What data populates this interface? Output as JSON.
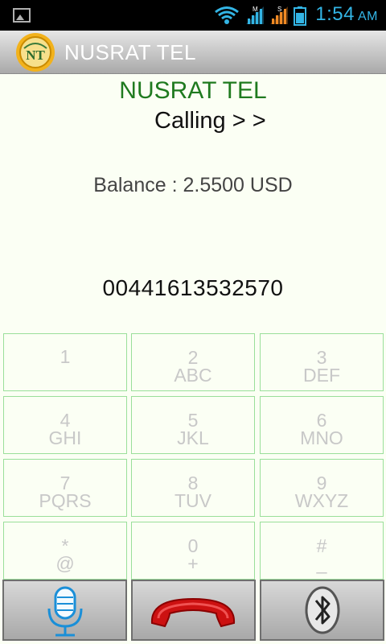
{
  "status_bar": {
    "time": "1:54",
    "ampm": "AM",
    "colors": {
      "icons": "#33b5e5",
      "signal_alt": "#f08a24"
    }
  },
  "action_bar": {
    "title": "NUSRAT TEL",
    "logo_text": "NT"
  },
  "call": {
    "brand": "NUSRAT TEL",
    "status": "Calling > >",
    "balance": "Balance : 2.5500 USD",
    "dialed_number": "00441613532570"
  },
  "keypad": {
    "keys": [
      {
        "digit": "1",
        "letters": ""
      },
      {
        "digit": "2",
        "letters": "ABC"
      },
      {
        "digit": "3",
        "letters": "DEF"
      },
      {
        "digit": "4",
        "letters": "GHI"
      },
      {
        "digit": "5",
        "letters": "JKL"
      },
      {
        "digit": "6",
        "letters": "MNO"
      },
      {
        "digit": "7",
        "letters": "PQRS"
      },
      {
        "digit": "8",
        "letters": "TUV"
      },
      {
        "digit": "9",
        "letters": "WXYZ"
      },
      {
        "digit": "*",
        "letters": "@"
      },
      {
        "digit": "0",
        "letters": "+"
      },
      {
        "digit": "#",
        "letters": "_"
      }
    ]
  },
  "actions": {
    "left_icon": "microphone-icon",
    "center_icon": "hang-up-icon",
    "right_icon": "bluetooth-icon"
  },
  "theme": {
    "brand_green": "#1f7a1f",
    "key_border": "#9adf9a",
    "background": "#fbfff4",
    "hangup_red": "#cc1111"
  }
}
